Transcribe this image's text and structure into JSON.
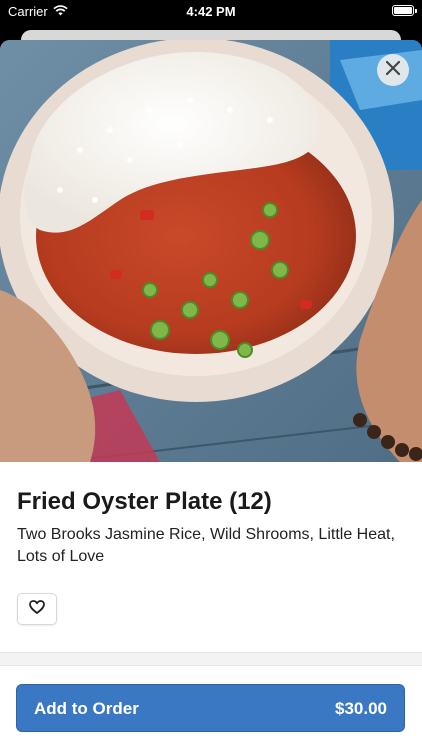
{
  "status_bar": {
    "carrier": "Carrier",
    "time": "4:42 PM"
  },
  "item": {
    "title": "Fried Oyster Plate (12)",
    "description": "Two Brooks Jasmine Rice, Wild Shrooms, Little Heat, Lots of Love"
  },
  "actions": {
    "add_to_order_label": "Add to Order",
    "price": "$30.00"
  },
  "icons": {
    "close": "close-icon",
    "favorite": "heart-icon",
    "wifi": "wifi-icon",
    "battery": "battery-icon"
  },
  "colors": {
    "accent": "#3b78c4",
    "text": "#1a1a1a",
    "status_bar": "#000000"
  }
}
